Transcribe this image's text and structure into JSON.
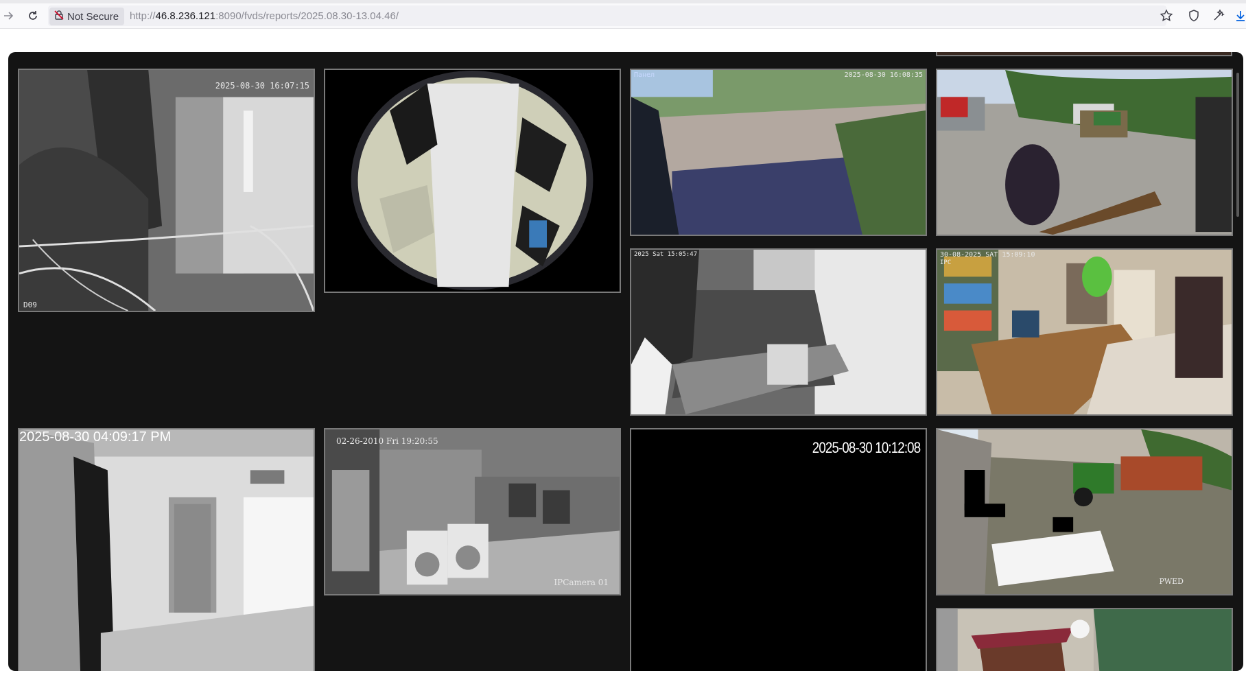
{
  "browser": {
    "security_label": "Not Secure",
    "url_scheme": "http://",
    "url_host": "46.8.236.121",
    "url_rest": ":8090/fvds/reports/2025.08.30-13.04.46/",
    "icons": [
      "back-arrow-icon",
      "reload-icon",
      "insecure-lock-icon",
      "bookmark-star-icon",
      "shield-icon",
      "extensions-icon",
      "download-icon"
    ]
  },
  "cameras": [
    {
      "id": "cam1",
      "stamp": "2025-08-30 16:07:15",
      "corner_label": "D09"
    },
    {
      "id": "cam2",
      "stamp": ""
    },
    {
      "id": "cam3",
      "stamp": "2025-08-30 16:08:35",
      "overlay_label": "Панел"
    },
    {
      "id": "cam4",
      "stamp": ""
    },
    {
      "id": "cam5",
      "stamp": "2025 Sat 15:05:47"
    },
    {
      "id": "cam6",
      "stamp": "30-08-2025 SAT 15:09:10",
      "overlay_label": "IPC"
    },
    {
      "id": "cam7",
      "stamp": "2025-08-30 04:09:17 PM"
    },
    {
      "id": "cam8",
      "stamp": "02-26-2010 Fri 19:20:55",
      "corner_label": "IPCamera 01"
    },
    {
      "id": "cam9",
      "stamp": "2025-08-30 10:12:08"
    },
    {
      "id": "cam10",
      "stamp": "",
      "corner_label": "PWED"
    },
    {
      "id": "cam11",
      "stamp": ""
    }
  ],
  "colors": {
    "page_bg": "#141414",
    "tile_border": "#7a7a7a",
    "toolbar_bg": "#f9f9fb"
  }
}
